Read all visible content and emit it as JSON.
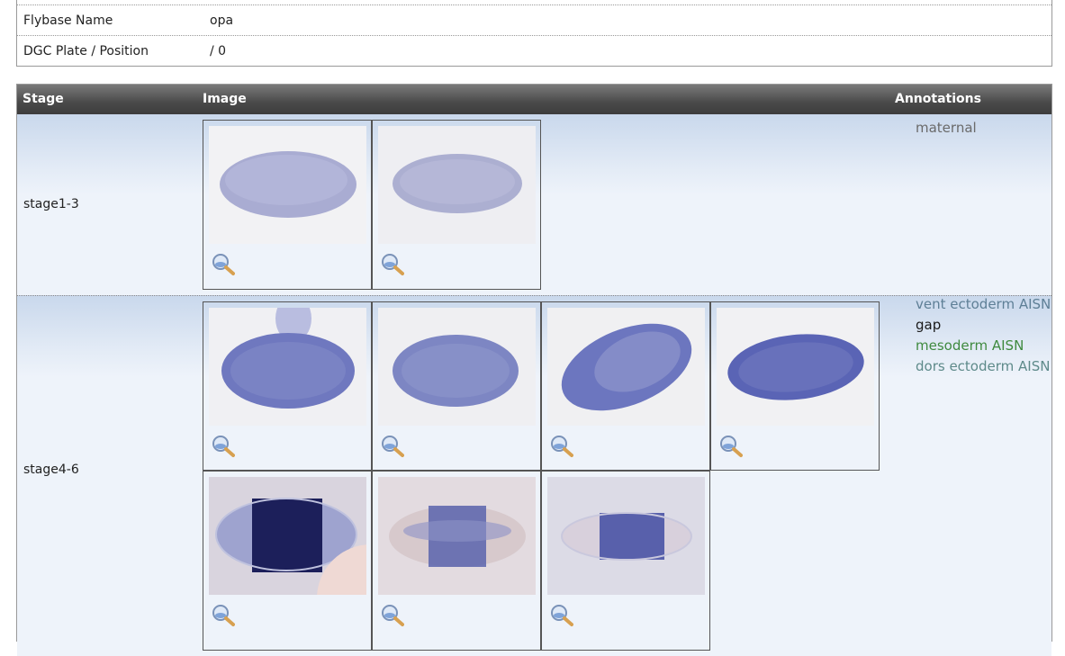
{
  "info": {
    "rows": [
      {
        "label": "Flybase Name",
        "value": "opa"
      },
      {
        "label": "DGC Plate / Position",
        "value": "/ 0"
      }
    ]
  },
  "table": {
    "headers": {
      "stage": "Stage",
      "image": "Image",
      "annotations": "Annotations"
    },
    "rows": [
      {
        "stage": "stage1-3",
        "images": [
          "embryo-image",
          "embryo-image"
        ],
        "annotations": [
          {
            "text": "maternal",
            "color": "#6a6a6a"
          }
        ]
      },
      {
        "stage": "stage4-6",
        "images": [
          "embryo-image",
          "embryo-image",
          "embryo-image",
          "embryo-image",
          "embryo-image",
          "embryo-image",
          "embryo-image"
        ],
        "annotations": [
          {
            "text": "vent ectoderm AISN",
            "color": "#5e7f96"
          },
          {
            "text": "gap",
            "color": "#1a1a1a"
          },
          {
            "text": "mesoderm AISN",
            "color": "#3f8a3f"
          },
          {
            "text": "dors ectoderm AISN",
            "color": "#5e8a8a"
          }
        ]
      }
    ]
  },
  "icons": {
    "zoom": "magnifier-zoom-icon"
  },
  "colors": {
    "header_dark": "#3d3d3d",
    "row_bg": "#eef3fa",
    "stain_blue": "#4a5aa8"
  }
}
